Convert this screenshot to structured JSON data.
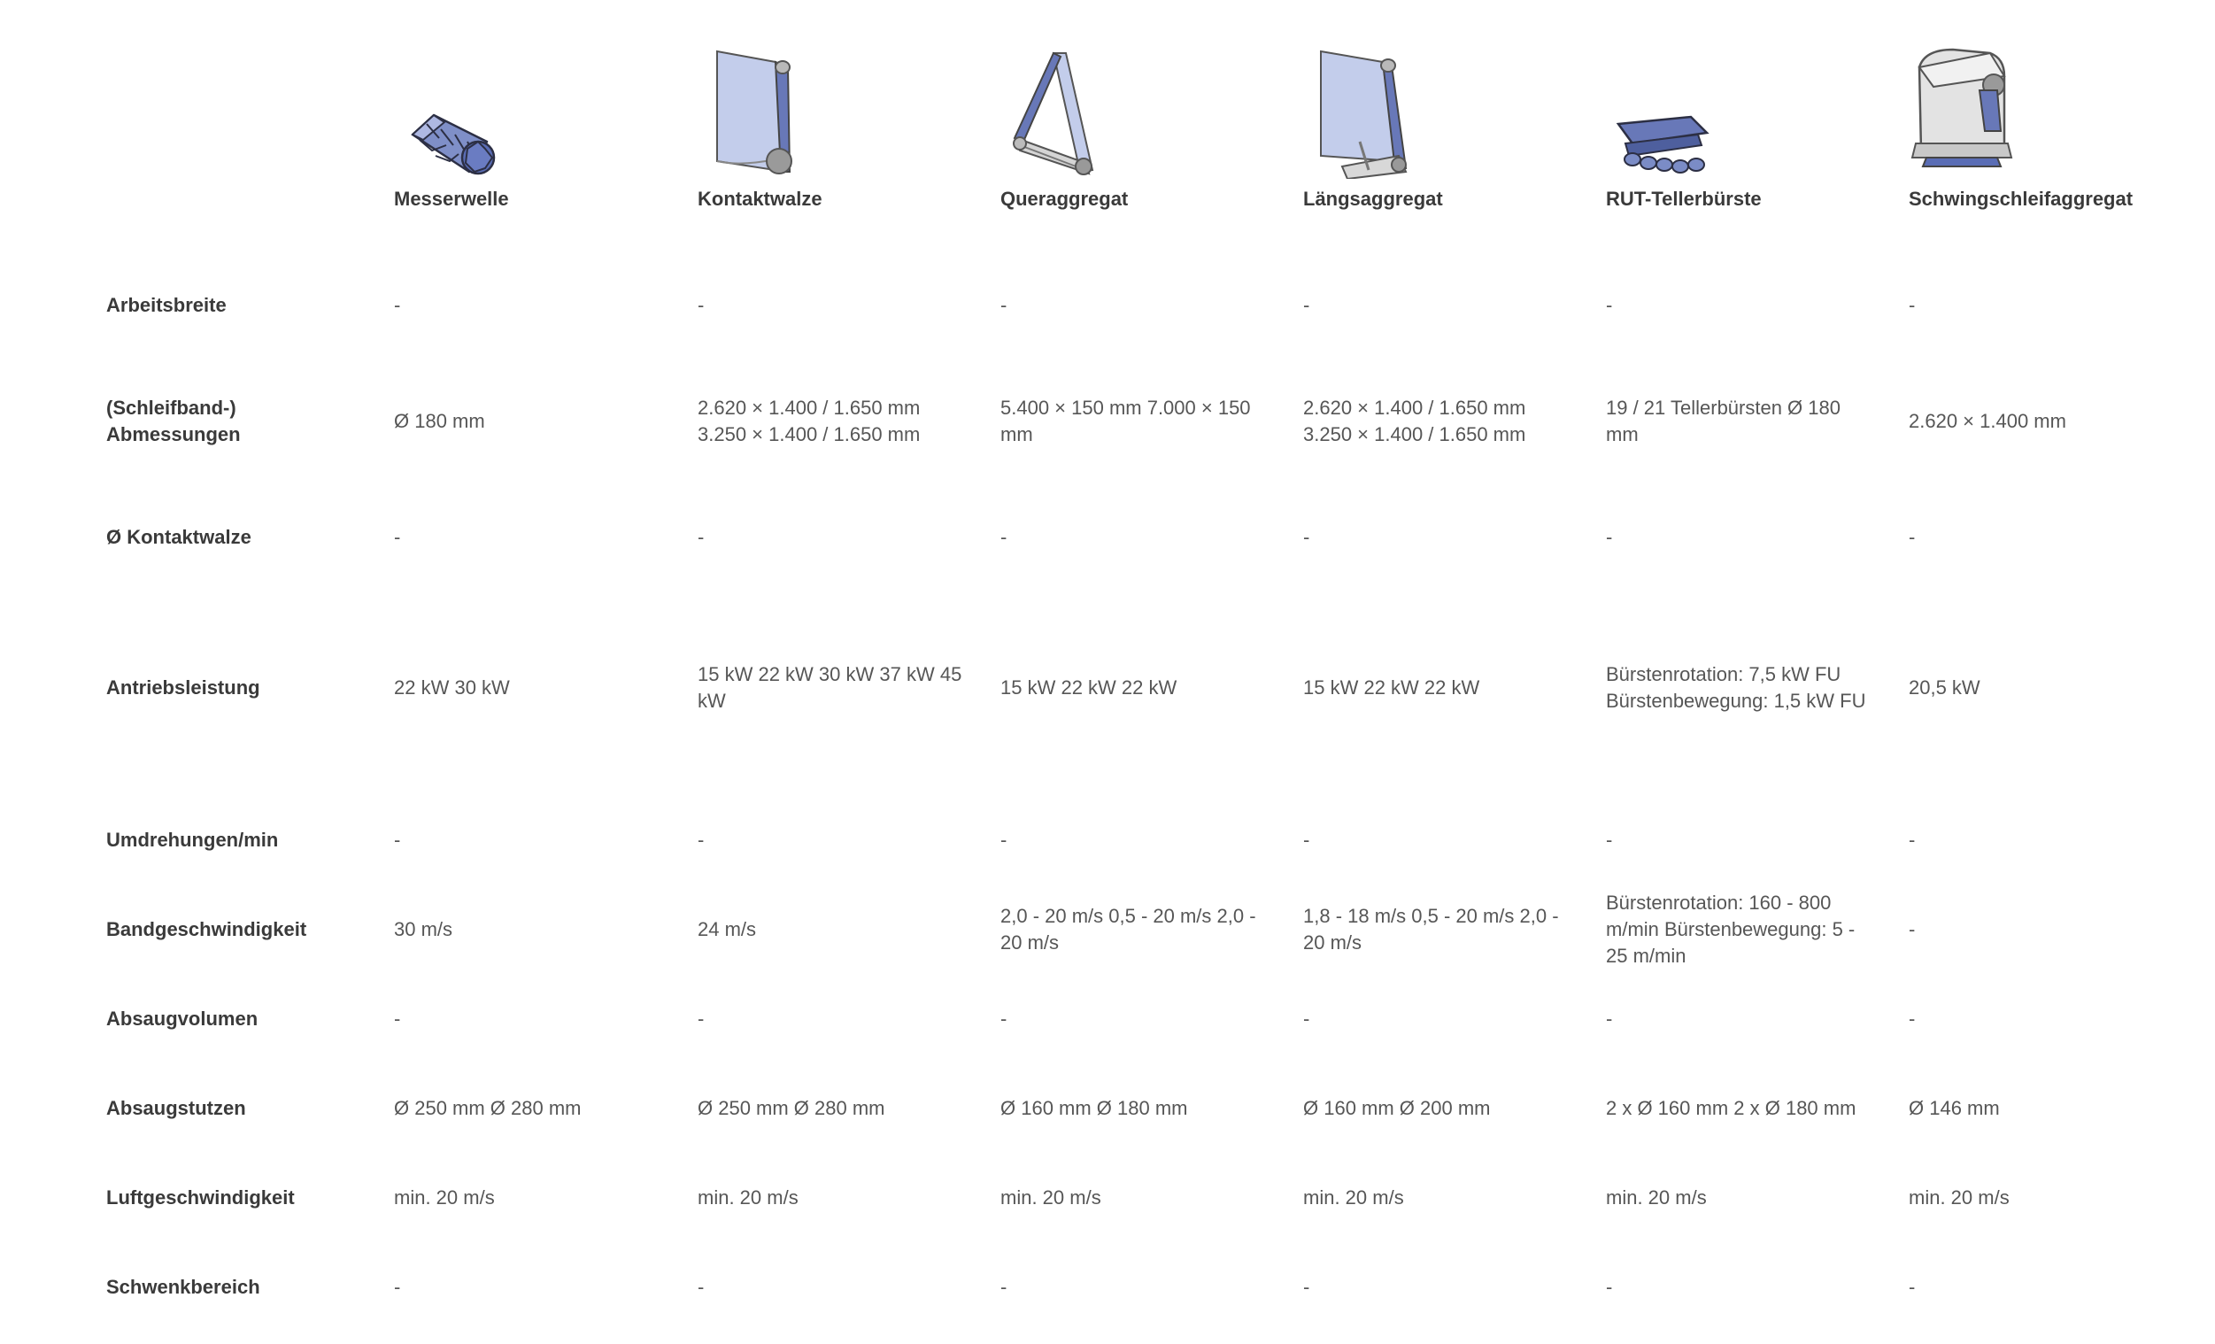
{
  "colors": {
    "label": "#3a3a3a",
    "value": "#565656",
    "belt_light": "#c3cdeb",
    "belt_dark": "#6878b8",
    "metal": "#c7c7c7"
  },
  "aggregates": [
    {
      "name": "Messerwelle",
      "icon": "knife-shaft-icon"
    },
    {
      "name": "Kontaktwalze",
      "icon": "contact-roller-icon"
    },
    {
      "name": "Queraggregat",
      "icon": "cross-unit-icon"
    },
    {
      "name": "Längsaggregat",
      "icon": "longitudinal-unit-icon"
    },
    {
      "name": "RUT-Tellerbürste",
      "icon": "disc-brush-icon"
    },
    {
      "name": "Schwingschleifaggregat",
      "icon": "orbital-sander-icon"
    }
  ],
  "rows": [
    {
      "label": "Arbeitsbreite",
      "values": [
        "-",
        "-",
        "-",
        "-",
        "-",
        "-"
      ]
    },
    {
      "label": "(Schleifband-) Abmessungen",
      "values": [
        "Ø 180 mm",
        "2.620 × 1.400 / 1.650 mm 3.250 × 1.400 / 1.650 mm",
        "5.400 × 150 mm 7.000 × 150 mm",
        "2.620 × 1.400 / 1.650 mm 3.250 × 1.400 / 1.650 mm",
        "19 / 21 Tellerbürsten Ø 180 mm",
        "2.620 × 1.400 mm"
      ]
    },
    {
      "label": "Ø Kontaktwalze",
      "values": [
        "-",
        "-",
        "-",
        "-",
        "-",
        "-"
      ]
    },
    {
      "label": "Antriebsleistung",
      "values": [
        "22 kW 30 kW",
        "15 kW 22 kW 30 kW 37 kW 45 kW",
        "15 kW 22 kW 22 kW",
        "15 kW 22 kW 22 kW",
        "Bürstenrotation: 7,5 kW FU Bürstenbewegung: 1,5 kW FU",
        "20,5 kW"
      ]
    },
    {
      "label": "Umdrehungen/min",
      "values": [
        "-",
        "-",
        "-",
        "-",
        "-",
        "-"
      ]
    },
    {
      "label": "Bandgeschwindigkeit",
      "values": [
        "30 m/s",
        "24 m/s",
        "2,0 - 20 m/s 0,5 - 20 m/s 2,0 - 20 m/s",
        "1,8 - 18 m/s 0,5 - 20 m/s 2,0 - 20 m/s",
        "Bürstenrotation: 160 - 800 m/min Bürstenbewegung: 5 - 25 m/min",
        "-"
      ]
    },
    {
      "label": "Absaugvolumen",
      "values": [
        "-",
        "-",
        "-",
        "-",
        "-",
        "-"
      ]
    },
    {
      "label": "Absaugstutzen",
      "values": [
        "Ø 250 mm Ø 280 mm",
        "Ø 250 mm Ø 280 mm",
        "Ø 160 mm Ø 180 mm",
        "Ø 160 mm Ø 200 mm",
        "2 x Ø 160 mm 2 x Ø 180 mm",
        "Ø 146 mm"
      ]
    },
    {
      "label": "Luftgeschwindigkeit",
      "values": [
        "min. 20 m/s",
        "min. 20 m/s",
        "min. 20 m/s",
        "min. 20 m/s",
        "min. 20 m/s",
        "min. 20 m/s"
      ]
    },
    {
      "label": "Schwenkbereich",
      "values": [
        "-",
        "-",
        "-",
        "-",
        "-",
        "-"
      ]
    }
  ]
}
